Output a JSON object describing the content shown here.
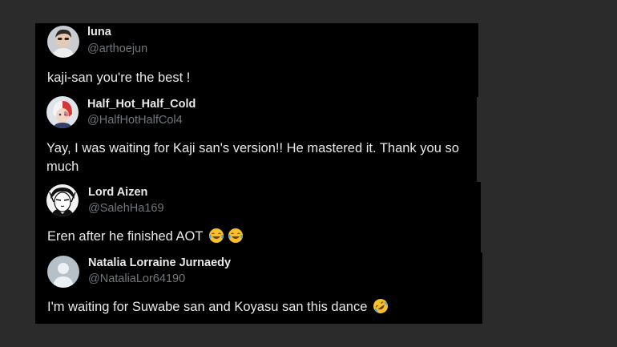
{
  "colors": {
    "page_background": "#2b2b2b",
    "card_background": "#000000",
    "name_color": "#e7e9ea",
    "handle_color": "#71767b",
    "text_color": "#e7e9ea"
  },
  "replies": [
    {
      "display_name": "luna",
      "handle": "@arthoejun",
      "text": "kaji-san you're the best !",
      "avatar_icon": "profile-photo"
    },
    {
      "display_name": "Half_Hot_Half_Cold",
      "handle": "@HalfHotHalfCol4",
      "text": "Yay, I was waiting for Kaji san's version!! He mastered it. Thank you so much",
      "avatar_icon": "anime-character-avatar"
    },
    {
      "display_name": "Lord Aizen",
      "handle": "@SalehHa169",
      "text": "Eren after he finished AOT",
      "emojis": [
        "tears-of-joy-emoji",
        "tears-of-joy-emoji"
      ],
      "avatar_icon": "sketch-portrait-avatar"
    },
    {
      "display_name": "Natalia Lorraine Jurnaedy",
      "handle": "@NataliaLor64190",
      "text": "I'm waiting for Suwabe san and Koyasu san this dance",
      "emojis": [
        "rolling-on-floor-laughing-emoji"
      ],
      "avatar_icon": "default-profile-avatar"
    }
  ]
}
